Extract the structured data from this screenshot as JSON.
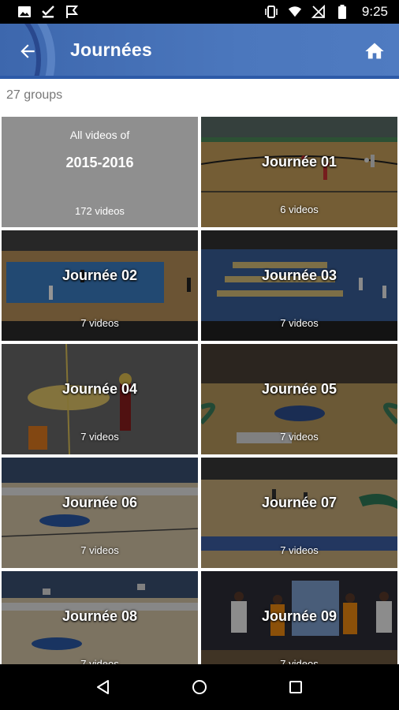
{
  "status_bar": {
    "time": "9:25",
    "left_icons": [
      "image-icon",
      "check-download-icon",
      "flag-icon"
    ],
    "right_icons": [
      "vibrate-icon",
      "wifi-icon",
      "no-signal-icon",
      "battery-icon"
    ]
  },
  "app_bar": {
    "title": "Journées",
    "back_icon": "arrow-left-icon",
    "home_icon": "home-icon",
    "brand_color": "#4a76bb"
  },
  "group_count": "27 groups",
  "all_videos": {
    "prefix": "All videos of",
    "season": "2015-2016",
    "count": "172 videos"
  },
  "groups": [
    {
      "title": "Journée 01",
      "count": "6 videos"
    },
    {
      "title": "Journée 02",
      "count": "7 videos"
    },
    {
      "title": "Journée 03",
      "count": "7 videos"
    },
    {
      "title": "Journée 04",
      "count": "7 videos"
    },
    {
      "title": "Journée 05",
      "count": "7 videos"
    },
    {
      "title": "Journée 06",
      "count": "7 videos"
    },
    {
      "title": "Journée 07",
      "count": "7 videos"
    },
    {
      "title": "Journée 08",
      "count": "7 videos"
    },
    {
      "title": "Journée 09",
      "count": "7 videos"
    }
  ],
  "nav_bar": {
    "icons": [
      "nav-back-icon",
      "nav-home-icon",
      "nav-recents-icon"
    ]
  }
}
